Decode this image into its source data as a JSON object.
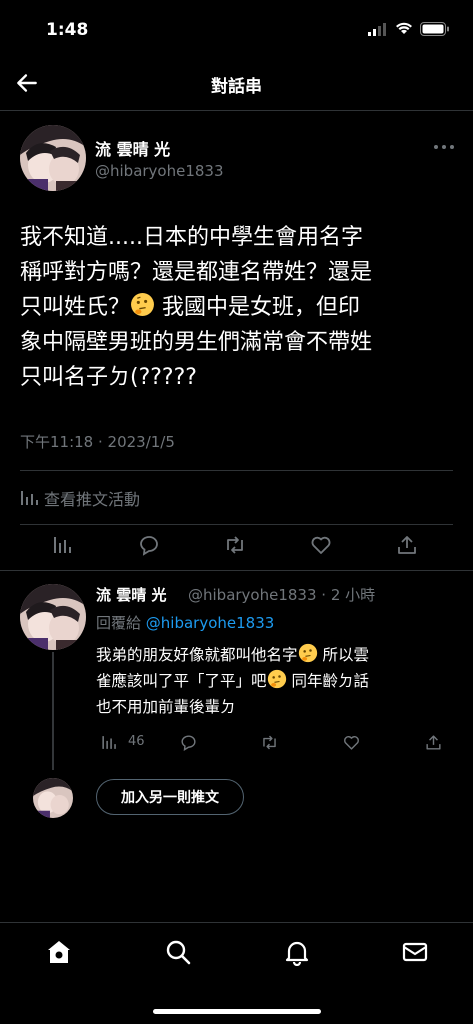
{
  "status_bar": {
    "time": "1:48"
  },
  "header": {
    "title": "對話串"
  },
  "main_tweet": {
    "display_name": "流 雲晴 光",
    "handle": "@hibaryohe1833",
    "text_part1": "我不知道.....日本的中學生會用名字\n稱呼對方嗎？還是都連名帶姓？還是\n只叫姓氏？",
    "text_part2": " 我國中是女班，但印\n象中隔壁男班的男生們滿常會不帶姓\n只叫名子ㄉ(?????",
    "timestamp": "下午11:18 · 2023/1/5",
    "activity_label": "查看推文活動"
  },
  "reply": {
    "display_name": "流 雲晴 光",
    "meta": "@hibaryohe1833 · 2 小時",
    "replying_prefix": "回覆給",
    "replying_to": "@hibaryohe1833",
    "text_part1": "我弟的朋友好像就都叫他名字",
    "text_part2": " 所以雲\n雀應該叫了平「了平」吧",
    "text_part3": " 同年齡ㄉ話\n也不用加前輩後輩ㄉ",
    "views": "46"
  },
  "compose": {
    "add_button": "加入另一則推文"
  },
  "icons": {
    "back": "arrow-left-icon",
    "more": "more-dots-icon",
    "thinking": "thinking-face-emoji-icon",
    "analytics": "analytics-icon",
    "reply": "reply-icon",
    "retweet": "retweet-icon",
    "like": "heart-icon",
    "share": "share-icon",
    "home": "home-icon",
    "search": "search-icon",
    "notifications": "bell-icon",
    "messages": "mail-icon"
  },
  "colors": {
    "background": "#000000",
    "link": "#1d9bf0",
    "muted": "#71767b",
    "divider": "#2f3336"
  }
}
